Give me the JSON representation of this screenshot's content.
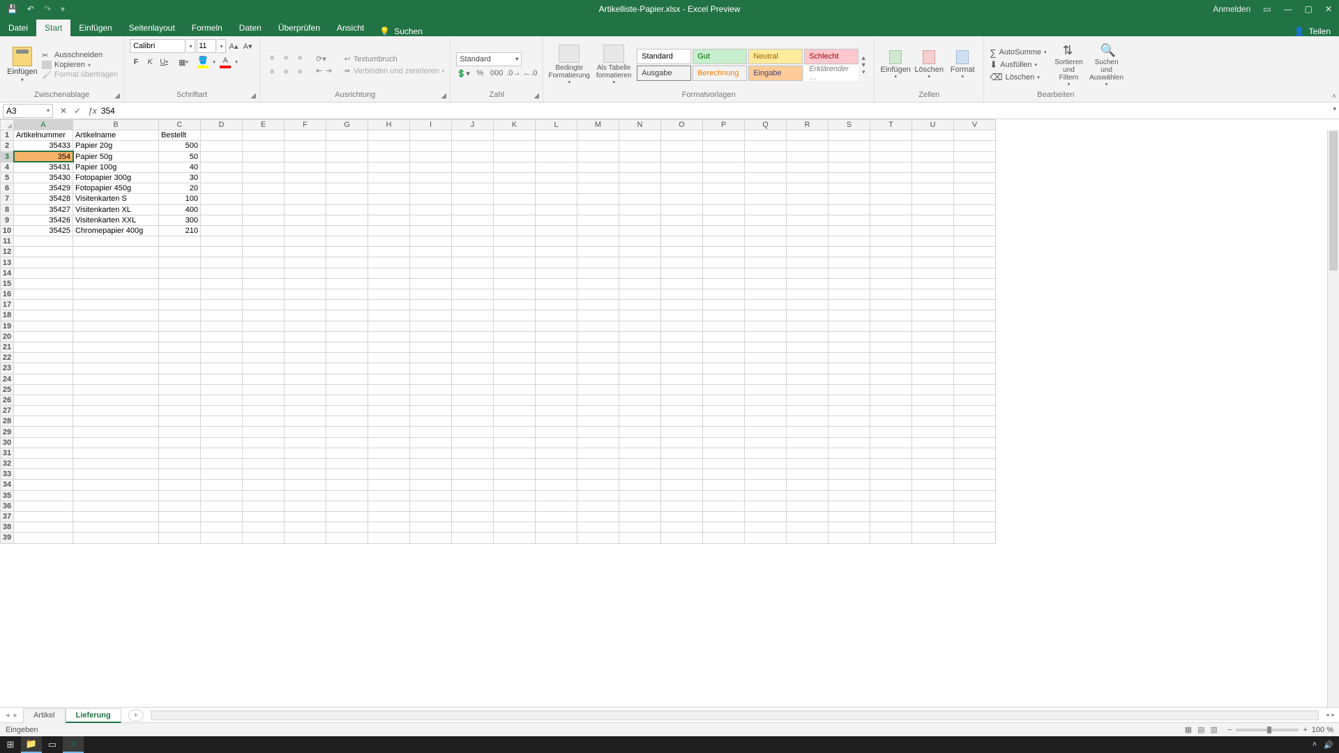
{
  "titlebar": {
    "doc": "Artikelliste-Papier.xlsx",
    "suffix": "Excel Preview",
    "signin": "Anmelden"
  },
  "tabs": {
    "file": "Datei",
    "items": [
      "Start",
      "Einfügen",
      "Seitenlayout",
      "Formeln",
      "Daten",
      "Überprüfen",
      "Ansicht"
    ],
    "active": "Start",
    "search": "Suchen",
    "share": "Teilen"
  },
  "ribbon": {
    "clipboard": {
      "paste": "Einfügen",
      "cut": "Ausschneiden",
      "copy": "Kopieren",
      "painter": "Format übertragen",
      "group": "Zwischenablage"
    },
    "font": {
      "name": "Calibri",
      "size": "11",
      "group": "Schriftart"
    },
    "align": {
      "wrap": "Textumbruch",
      "merge": "Verbinden und zentrieren",
      "group": "Ausrichtung"
    },
    "number": {
      "format": "Standard",
      "group": "Zahl"
    },
    "styles": {
      "cond": "Bedingte Formatierung",
      "table": "Als Tabelle formatieren",
      "row1": [
        "Standard",
        "Gut",
        "Neutral",
        "Schlecht"
      ],
      "row2": [
        "Ausgabe",
        "Berechnung",
        "Eingabe",
        "Erklärender …"
      ],
      "group": "Formatvorlagen"
    },
    "cells": {
      "insert": "Einfügen",
      "delete": "Löschen",
      "format": "Format",
      "group": "Zellen"
    },
    "editing": {
      "autosum": "AutoSumme",
      "fill": "Ausfüllen",
      "clear": "Löschen",
      "sort": "Sortieren und Filtern",
      "find": "Suchen und Auswählen",
      "group": "Bearbeiten"
    }
  },
  "formulabar": {
    "ref": "A3",
    "value": "354"
  },
  "columns": [
    "A",
    "B",
    "C",
    "D",
    "E",
    "F",
    "G",
    "H",
    "I",
    "J",
    "K",
    "L",
    "M",
    "N",
    "O",
    "P",
    "Q",
    "R",
    "S",
    "T",
    "U",
    "V"
  ],
  "row_count": 39,
  "selected_cell": {
    "row": 3,
    "col": "A"
  },
  "headers": [
    "Artikelnummer",
    "Artikelname",
    "Bestellt"
  ],
  "rows": [
    {
      "n": "2",
      "a": "35433",
      "b": "Papier 20g",
      "c": "500"
    },
    {
      "n": "3",
      "a": "354",
      "b": "Papier 50g",
      "c": "50"
    },
    {
      "n": "4",
      "a": "35431",
      "b": "Papier 100g",
      "c": "40"
    },
    {
      "n": "5",
      "a": "35430",
      "b": "Fotopapier 300g",
      "c": "30"
    },
    {
      "n": "6",
      "a": "35429",
      "b": "Fotopapier 450g",
      "c": "20"
    },
    {
      "n": "7",
      "a": "35428",
      "b": "Visitenkarten S",
      "c": "100"
    },
    {
      "n": "8",
      "a": "35427",
      "b": "Visitenkarten XL",
      "c": "400"
    },
    {
      "n": "9",
      "a": "35426",
      "b": "Visitenkarten XXL",
      "c": "300"
    },
    {
      "n": "10",
      "a": "35425",
      "b": "Chromepapier 400g",
      "c": "210"
    }
  ],
  "sheets": {
    "tabs": [
      "Artikel",
      "Lieferung"
    ],
    "active": "Lieferung"
  },
  "statusbar": {
    "mode": "Eingeben",
    "zoom": "100 %"
  },
  "gallery_styles": {
    "Standard": {
      "bg": "#ffffff",
      "fg": "#000000",
      "border": "#c4c4c4"
    },
    "Gut": {
      "bg": "#c6efce",
      "fg": "#006100",
      "border": "#c4c4c4"
    },
    "Neutral": {
      "bg": "#ffeb9c",
      "fg": "#9c6500",
      "border": "#c4c4c4"
    },
    "Schlecht": {
      "bg": "#ffc7ce",
      "fg": "#9c0006",
      "border": "#c4c4c4"
    },
    "Ausgabe": {
      "bg": "#f2f2f2",
      "fg": "#3f3f3f",
      "border": "#7f7f7f"
    },
    "Berechnung": {
      "bg": "#f2f2f2",
      "fg": "#fa7d00",
      "border": "#bfbfbf"
    },
    "Eingabe": {
      "bg": "#ffcc99",
      "fg": "#3f3f76",
      "border": "#bfbfbf"
    },
    "Erklärender …": {
      "bg": "#ffffff",
      "fg": "#7f7f7f",
      "border": "#ffffff",
      "italic": true
    }
  }
}
